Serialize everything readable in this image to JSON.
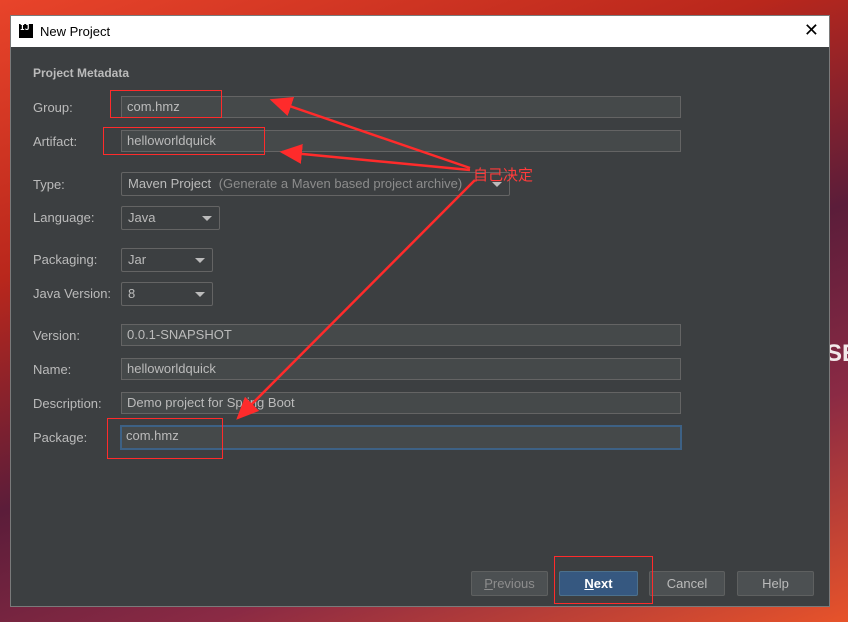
{
  "window": {
    "title": "New Project",
    "icon": "intellij-icon"
  },
  "background": {
    "partial_text": "SE"
  },
  "section": {
    "title": "Project Metadata"
  },
  "form": {
    "group": {
      "label": "Group:",
      "value": "com.hmz"
    },
    "artifact": {
      "label": "Artifact:",
      "value": "helloworldquick"
    },
    "type": {
      "label": "Type:",
      "value": "Maven Project",
      "hint": "(Generate a Maven based project archive)"
    },
    "language": {
      "label": "Language:",
      "value": "Java"
    },
    "packaging": {
      "label": "Packaging:",
      "value": "Jar"
    },
    "java_version": {
      "label": "Java Version:",
      "value": "8"
    },
    "version": {
      "label": "Version:",
      "value": "0.0.1-SNAPSHOT"
    },
    "name": {
      "label": "Name:",
      "value": "helloworldquick"
    },
    "description": {
      "label": "Description:",
      "value": "Demo project for Spring Boot"
    },
    "package": {
      "label": "Package:",
      "value": "com.hmz"
    }
  },
  "buttons": {
    "previous": {
      "mnemonic": "P",
      "rest": "revious"
    },
    "next": {
      "mnemonic": "N",
      "rest": "ext"
    },
    "cancel": "Cancel",
    "help": "Help"
  },
  "annotation": {
    "text": "自己决定",
    "color": "#ff2b2b"
  }
}
